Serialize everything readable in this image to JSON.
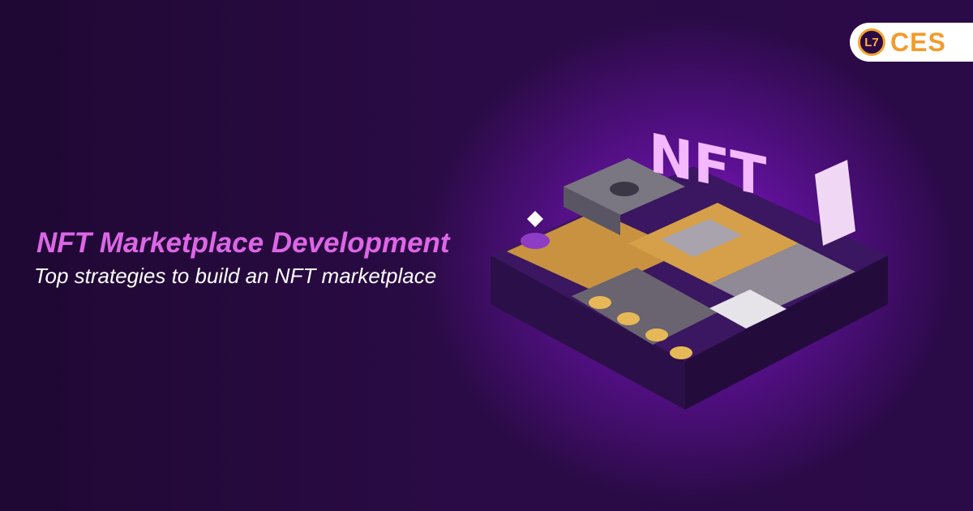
{
  "brand": {
    "name": "CES",
    "mark": "L7"
  },
  "hero": {
    "title": "NFT Marketplace Development",
    "subtitle": "Top strategies to build an NFT marketplace"
  },
  "illustration": {
    "sign_text": "NFT"
  },
  "colors": {
    "background": "#2a0b45",
    "glow": "#a428e6",
    "title": "#dd66e6",
    "subtitle": "#ffffff",
    "brand_accent": "#f29b2b"
  }
}
